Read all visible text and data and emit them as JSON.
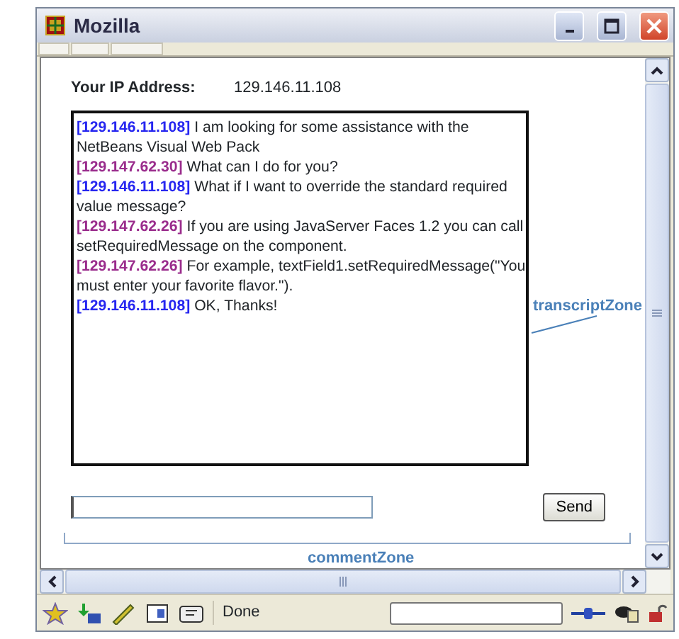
{
  "window": {
    "title": "Mozilla"
  },
  "ip": {
    "label": "Your IP Address:",
    "value": "129.146.11.108"
  },
  "transcript": [
    {
      "sender": "[129.146.11.108]",
      "text": "I am looking for some assistance with the NetBeans Visual Web Pack",
      "color": "#2626f0"
    },
    {
      "sender": "[129.147.62.30]",
      "text": "What can I do for you?",
      "color": "#9a2c8c"
    },
    {
      "sender": "[129.146.11.108]",
      "text": "What if I want to override the standard required value message?",
      "color": "#2626f0"
    },
    {
      "sender": "[129.147.62.26]",
      "text": "If you are using JavaServer Faces 1.2 you can call setRequiredMessage on the component.",
      "color": "#9a2c8c"
    },
    {
      "sender": "[129.147.62.26]",
      "text": "For example, textField1.setRequiredMessage(\"You must enter your favorite flavor.\").",
      "color": "#9a2c8c"
    },
    {
      "sender": "[129.146.11.108]",
      "text": "OK, Thanks!",
      "color": "#2626f0"
    }
  ],
  "send_button": "Send",
  "annotations": {
    "transcript_zone": "transcriptZone",
    "comment_zone": "commentZone"
  },
  "status_bar": {
    "text": "Done"
  }
}
